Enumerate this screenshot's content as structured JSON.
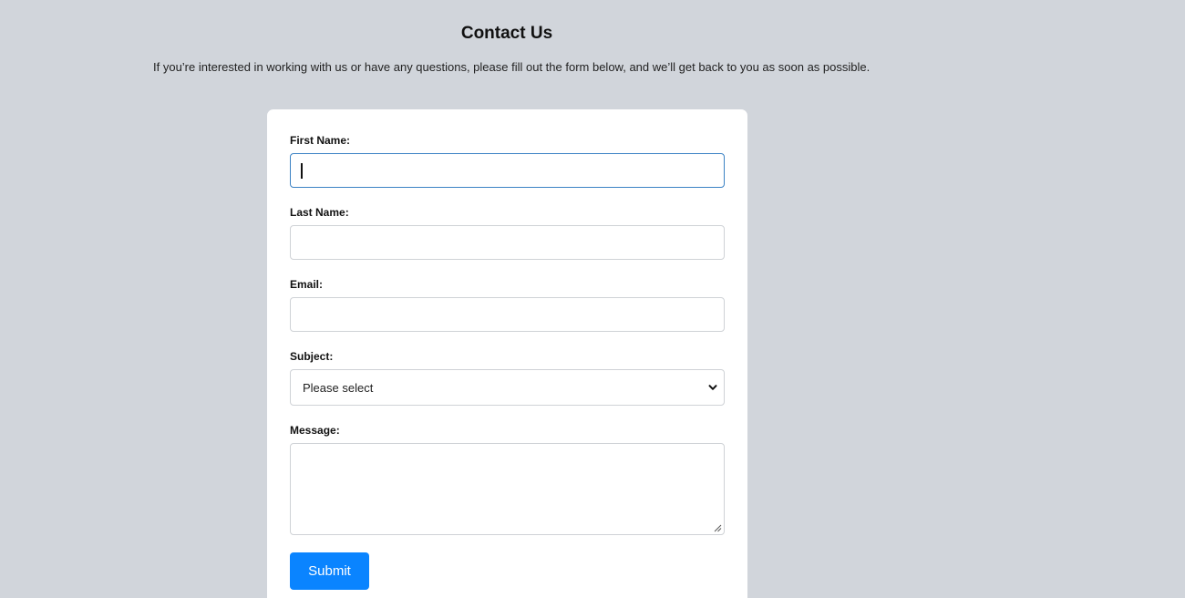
{
  "header": {
    "title": "Contact Us",
    "intro": "If you’re interested in working with us or have any questions, please fill out the form below, and we’ll get back to you as soon as possible."
  },
  "form": {
    "first_name": {
      "label": "First Name:",
      "value": ""
    },
    "last_name": {
      "label": "Last Name:",
      "value": ""
    },
    "email": {
      "label": "Email:",
      "value": ""
    },
    "subject": {
      "label": "Subject:",
      "selected": "Please select"
    },
    "message": {
      "label": "Message:",
      "value": ""
    },
    "submit_label": "Submit"
  },
  "icons": {
    "select_arrow": "chevron-down-icon",
    "textarea_resize": "resize-grip-icon"
  },
  "colors": {
    "page_background": "#d1d5db",
    "card_background": "#ffffff",
    "focus_border": "#3b82c4",
    "submit_button": "#0a84ff"
  }
}
